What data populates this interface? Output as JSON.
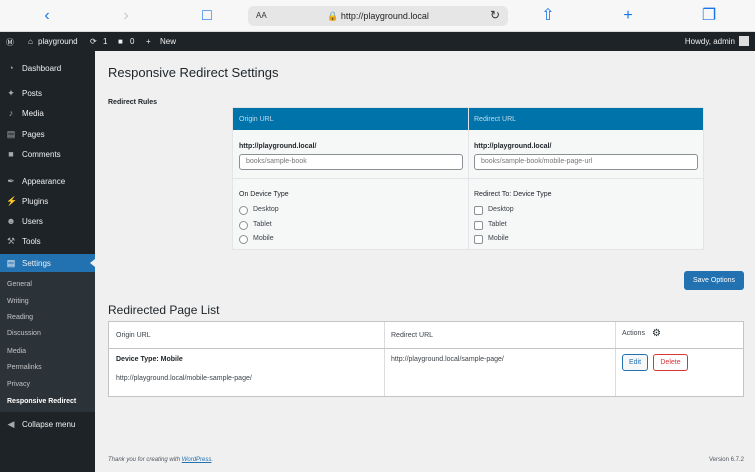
{
  "browser": {
    "text_size_label": "AA",
    "url": "http://playground.local",
    "icons": [
      "back-icon",
      "forward-icon",
      "bookmarks-icon",
      "lock-icon",
      "reload-icon",
      "share-icon",
      "new-tab-icon",
      "tabs-icon"
    ]
  },
  "adminbar": {
    "site_name": "playground",
    "updates_count": "1",
    "comments_count": "0",
    "new_label": "New",
    "greeting": "Howdy, admin"
  },
  "sidebar": {
    "items": [
      {
        "label": "Dashboard",
        "icon": "dashboard-icon"
      },
      {
        "label": "Posts",
        "icon": "pin-icon"
      },
      {
        "label": "Media",
        "icon": "media-icon"
      },
      {
        "label": "Pages",
        "icon": "pages-icon"
      },
      {
        "label": "Comments",
        "icon": "comments-icon"
      },
      {
        "label": "Appearance",
        "icon": "brush-icon"
      },
      {
        "label": "Plugins",
        "icon": "plugin-icon"
      },
      {
        "label": "Users",
        "icon": "users-icon"
      },
      {
        "label": "Tools",
        "icon": "wrench-icon"
      },
      {
        "label": "Settings",
        "icon": "settings-icon"
      }
    ],
    "submenu": [
      "General",
      "Writing",
      "Reading",
      "Discussion",
      "Media",
      "Permalinks",
      "Privacy",
      "Responsive Redirect"
    ],
    "collapse_label": "Collapse menu"
  },
  "main": {
    "title": "Responsive Redirect Settings",
    "rules_label": "Redirect Rules",
    "rules": {
      "origin_header": "Origin URL",
      "redirect_header": "Redirect URL",
      "origin_base": "http://playground.local/",
      "origin_placeholder": "books/sample-book",
      "redirect_base": "http://playground.local/",
      "redirect_placeholder": "books/sample-book/mobile-page-url",
      "device_label": "On Device Type",
      "redirect_device_label": "Redirect To: Device Type",
      "devices": [
        "Desktop",
        "Tablet",
        "Mobile"
      ]
    },
    "save_label": "Save Options",
    "list_title": "Redirected Page List",
    "list": {
      "headers": [
        "Origin URL",
        "Redirect URL",
        "Actions"
      ],
      "row": {
        "device": "Device Type: Mobile",
        "origin": "http://playground.local/mobile-sample-page/",
        "redirect": "http://playground.local/sample-page/",
        "edit_label": "Edit",
        "delete_label": "Delete"
      }
    }
  },
  "footer": {
    "thanks_prefix": "Thank you for creating with",
    "wp_link": "WordPress",
    "thanks_suffix": ".",
    "version": "Version 6.7.2"
  },
  "colors": {
    "accent": "#2271b1",
    "table_header": "#0073aa",
    "danger": "#d63638",
    "sidebar": "#1d2327"
  }
}
